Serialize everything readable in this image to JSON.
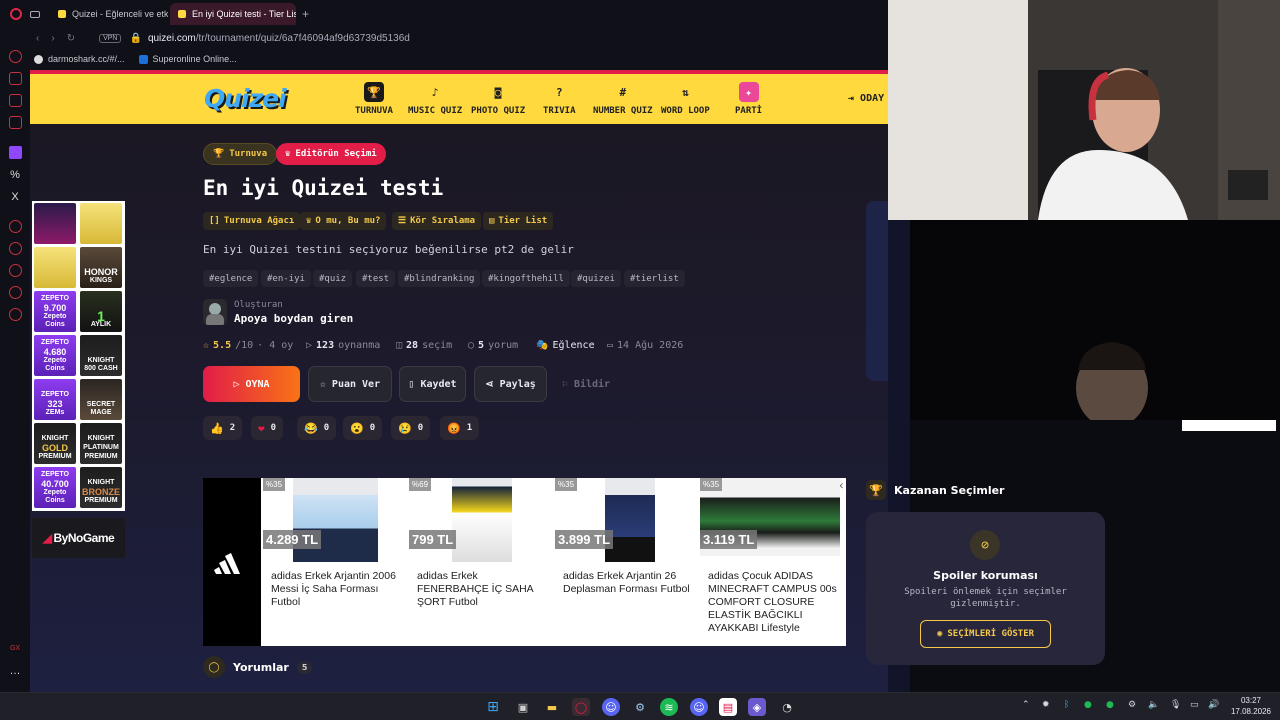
{
  "browser": {
    "tabs": [
      {
        "label": "Quizei - Eğlenceli ve etkile"
      },
      {
        "label": "En iyi Quizei testi - Tier List"
      }
    ],
    "vpn": "VPN",
    "url_host": "quizei.com",
    "url_path": "/tr/tournament/quiz/6a7f46094af9d63739d5136d",
    "bookmarks": [
      {
        "label": "darmoshark.cc/#/..."
      },
      {
        "label": "Superonline Online..."
      }
    ]
  },
  "site": {
    "logo": "Quizei",
    "nav": [
      {
        "label": "TURNUVA",
        "icon": "trophy-icon"
      },
      {
        "label": "MUSIC QUIZ",
        "icon": "music-icon"
      },
      {
        "label": "PHOTO QUIZ",
        "icon": "camera-icon"
      },
      {
        "label": "TRIVIA",
        "icon": "question-icon"
      },
      {
        "label": "NUMBER QUIZ",
        "icon": "hash-icon"
      },
      {
        "label": "WORD LOOP",
        "icon": "sort-icon"
      },
      {
        "label": "PARTİ",
        "icon": "party-icon"
      }
    ],
    "login": "ODAY"
  },
  "quiz": {
    "badges": {
      "tournament": "Turnuva",
      "editor": "Editörün Seçimi"
    },
    "title": "En iyi Quizei testi",
    "modes": [
      "Turnuva Ağacı",
      "O mu, Bu mu?",
      "Kör Sıralama",
      "Tier List"
    ],
    "description": "En iyi Quizei testini seçiyoruz beğenilirse pt2 de gelir",
    "tags": [
      "#eglence",
      "#en-iyi",
      "#quiz",
      "#test",
      "#blindranking",
      "#kingofthehill",
      "#quizei",
      "#tierlist"
    ],
    "creator_label": "Oluşturan",
    "creator_name": "Apoya boydan giren",
    "stats": {
      "rating": "5.5",
      "rating_max": "/10",
      "age": "· 4 oy",
      "plays": "123",
      "plays_label": "oynanma",
      "choices": "28",
      "choices_label": "seçim",
      "comments": "5",
      "comments_label": "yorum",
      "category": "Eğlence",
      "date": "14 Ağu 2026"
    },
    "actions": {
      "play": "OYNA",
      "rate": "Puan Ver",
      "save": "Kaydet",
      "share": "Paylaş",
      "report": "Bildir"
    },
    "reactions": [
      {
        "emoji": "👍",
        "count": "2"
      },
      {
        "emoji": "❤",
        "count": "0"
      },
      {
        "emoji": "😂",
        "count": "0"
      },
      {
        "emoji": "😮",
        "count": "0"
      },
      {
        "emoji": "😢",
        "count": "0"
      },
      {
        "emoji": "😡",
        "count": "1"
      }
    ]
  },
  "ad": {
    "products": [
      {
        "discount": "%35",
        "price": "4.289 TL",
        "name": "adidas Erkek Arjantin 2006 Messi İç Saha Forması Futbol"
      },
      {
        "discount": "%69",
        "price": "799 TL",
        "name": "adidas Erkek FENERBAHÇE İÇ SAHA ŞORT Futbol"
      },
      {
        "discount": "%35",
        "price": "3.899 TL",
        "name": "adidas Erkek Arjantin 26 Deplasman Forması Futbol"
      },
      {
        "discount": "%35",
        "price": "3.119 TL",
        "name": "adidas Çocuk ADIDAS MINECRAFT CAMPUS 00s COMFORT CLOSURE ELASTİK BAĞCIKLI AYAKKABI Lifestyle"
      }
    ]
  },
  "winners": {
    "title": "Kazanan Seçimler",
    "spoiler_title": "Spoiler koruması",
    "spoiler_desc": "Spoileri önlemek için seçimler gizlenmiştir.",
    "show_button": "SEÇİMLERİ GÖSTER"
  },
  "comments": {
    "title": "Yorumlar",
    "count": "5"
  },
  "side_ads": {
    "tiles": [
      {
        "top": "",
        "big": "",
        "bottom": ""
      },
      {
        "top": "",
        "big": "",
        "bottom": ""
      },
      {
        "top": "",
        "big": "",
        "bottom": ""
      },
      {
        "top": "",
        "big": "HONOR",
        "bottom": "KINGS"
      },
      {
        "top": "ZEPETO",
        "big": "9.700",
        "bottom": "Zepeto Coins"
      },
      {
        "top": "",
        "big": "1",
        "bottom": "AYLIK"
      },
      {
        "top": "ZEPETO",
        "big": "4.680",
        "bottom": "Zepeto Coins"
      },
      {
        "top": "KNIGHT",
        "big": "",
        "bottom": "800 CASH"
      },
      {
        "top": "ZEPETO",
        "big": "323",
        "bottom": "ZEMs"
      },
      {
        "top": "SECRET MAGE",
        "big": "",
        "bottom": ""
      },
      {
        "top": "KNIGHT",
        "big": "GOLD",
        "bottom": "PREMIUM"
      },
      {
        "top": "KNIGHT",
        "big": "PLATINUM",
        "bottom": "PREMIUM"
      },
      {
        "top": "ZEPETO",
        "big": "40.700",
        "bottom": "Zepeto Coins"
      },
      {
        "top": "KNIGHT",
        "big": "BRONZE",
        "bottom": "PREMIUM"
      }
    ],
    "brand": "ByNoGame"
  },
  "taskbar": {
    "time": "03:27",
    "date": "17.08.2026"
  }
}
